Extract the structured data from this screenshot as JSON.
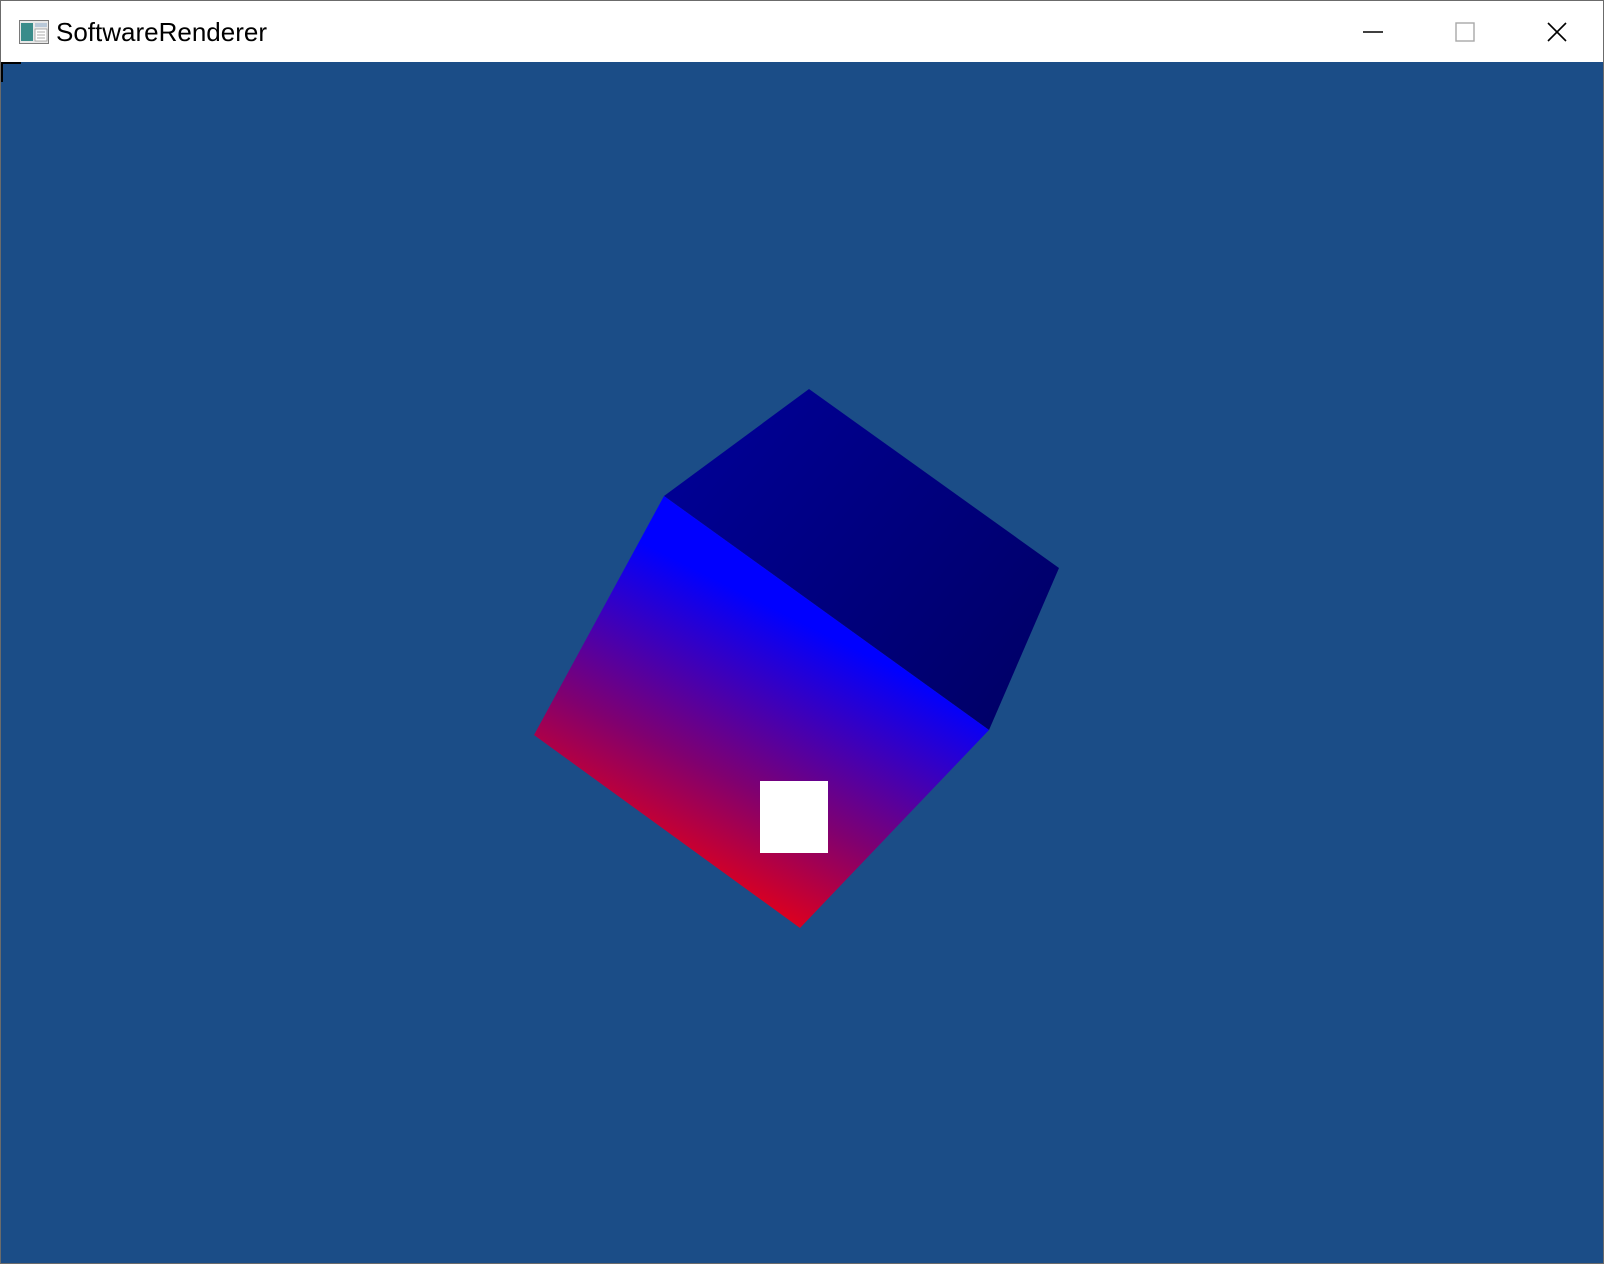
{
  "window": {
    "title": "SoftwareRenderer",
    "icon": "application-window-icon",
    "controls": [
      "minimize-icon",
      "maximize-icon",
      "close-icon"
    ]
  },
  "viewport": {
    "background_color": "#1b4d87",
    "scene": {
      "object": "rotating cube",
      "top_face_colors": [
        "#00008f",
        "#00006a"
      ],
      "front_face_gradient": [
        "#ff0000",
        "#0000ff"
      ],
      "overlay_square_color": "#ffffff",
      "corner_marker_color": "#000000"
    }
  }
}
